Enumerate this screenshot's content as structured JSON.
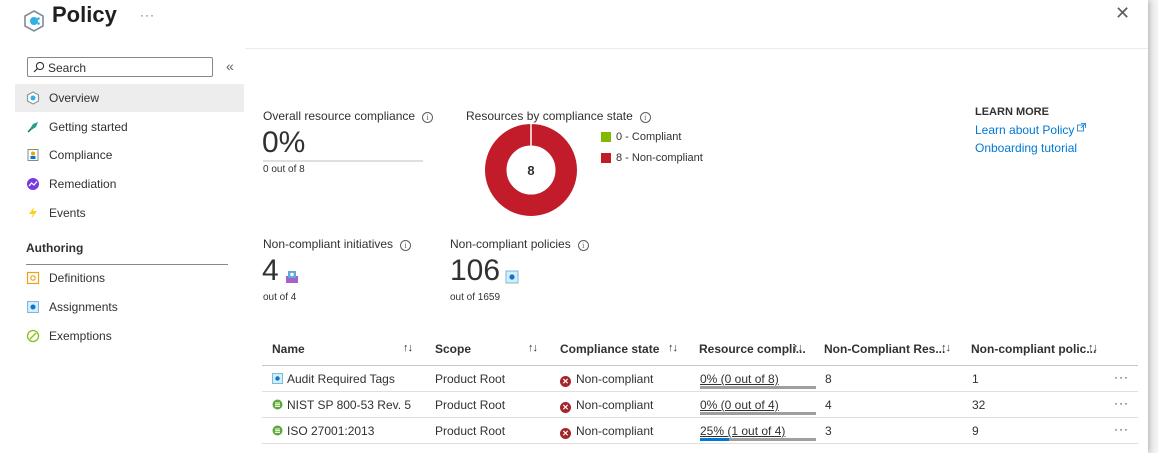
{
  "header": {
    "title": "Policy",
    "more": "···",
    "close": "✕"
  },
  "sidebar": {
    "search_placeholder": "Search",
    "collapse": "«",
    "items": [
      {
        "label": "Overview",
        "icon": "overview-icon",
        "active": true
      },
      {
        "label": "Getting started",
        "icon": "getting-started-icon"
      },
      {
        "label": "Compliance",
        "icon": "compliance-icon"
      },
      {
        "label": "Remediation",
        "icon": "remediation-icon"
      },
      {
        "label": "Events",
        "icon": "events-icon"
      }
    ],
    "section": "Authoring",
    "authoring": [
      {
        "label": "Definitions",
        "icon": "definitions-icon"
      },
      {
        "label": "Assignments",
        "icon": "assignments-icon"
      },
      {
        "label": "Exemptions",
        "icon": "exemptions-icon"
      }
    ]
  },
  "summary": {
    "overall_label": "Overall resource compliance",
    "overall_value": "0%",
    "overall_sub": "0 out of 8",
    "by_state_label": "Resources by compliance state",
    "donut_total": "8",
    "legend": [
      {
        "label": "0 - Compliant",
        "color": "#7fba00"
      },
      {
        "label": "8 - Non-compliant",
        "color": "#c21c2b"
      }
    ],
    "initiatives_label": "Non-compliant initiatives",
    "initiatives_value": "4",
    "initiatives_sub": "out of 4",
    "policies_label": "Non-compliant policies",
    "policies_value": "106",
    "policies_sub": "out of 1659"
  },
  "learn_more": {
    "heading": "LEARN MORE",
    "links": [
      "Learn about Policy",
      "Onboarding tutorial"
    ]
  },
  "table": {
    "columns": [
      "Name",
      "Scope",
      "Compliance state",
      "Resource compli...",
      "Non-Compliant Res...",
      "Non-compliant polic..."
    ],
    "sort_glyph": "↑↓",
    "rows": [
      {
        "name": "Audit Required Tags",
        "icon": "assignment-icon",
        "scope": "Product Root",
        "state": "Non-compliant",
        "compliance": "0% (0 out of 8)",
        "pct": 0,
        "resources": "8",
        "policies": "1",
        "more": "···"
      },
      {
        "name": "NIST SP 800-53 Rev. 5",
        "icon": "initiative-icon",
        "scope": "Product Root",
        "state": "Non-compliant",
        "compliance": "0% (0 out of 4)",
        "pct": 0,
        "resources": "4",
        "policies": "32",
        "more": "···"
      },
      {
        "name": "ISO 27001:2013",
        "icon": "initiative-icon",
        "scope": "Product Root",
        "state": "Non-compliant",
        "compliance": "25% (1 out of 4)",
        "pct": 25,
        "resources": "3",
        "policies": "9",
        "more": "···"
      }
    ]
  },
  "colors": {
    "accent": "#0078d4",
    "noncompliant": "#c21c2b",
    "compliant": "#7fba00"
  }
}
